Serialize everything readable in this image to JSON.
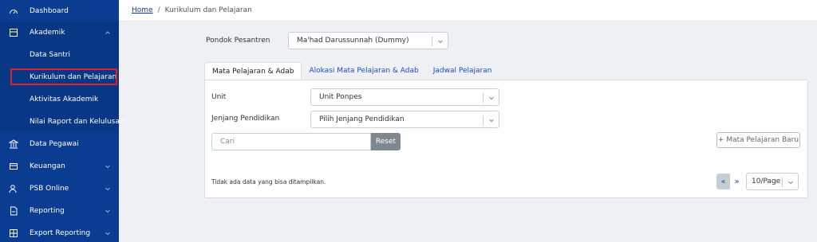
{
  "sidebar": {
    "items": [
      {
        "label": "Dashboard",
        "icon": "dashboard-icon"
      },
      {
        "label": "Akademik",
        "icon": "book-icon"
      },
      {
        "label": "Data Santri"
      },
      {
        "label": "Kurikulum dan Pelajaran"
      },
      {
        "label": "Aktivitas Akademik"
      },
      {
        "label": "Nilai Raport dan Kelulusan"
      },
      {
        "label": "Data Pegawai",
        "icon": "building-icon"
      },
      {
        "label": "Keuangan",
        "icon": "wallet-icon"
      },
      {
        "label": "PSB Online",
        "icon": "users-icon"
      },
      {
        "label": "Reporting",
        "icon": "file-icon"
      },
      {
        "label": "Export Reporting",
        "icon": "table-icon"
      }
    ]
  },
  "breadcrumb": {
    "home": "Home",
    "current": "Kurikulum dan Pelajaran"
  },
  "pesantren": {
    "label": "Pondok Pesantren",
    "value": "Ma'had Darussunnah (Dummy)"
  },
  "tabs": [
    {
      "label": "Mata Pelajaran & Adab"
    },
    {
      "label": "Alokasi Mata Pelajaran & Adab"
    },
    {
      "label": "Jadwal Pelajaran"
    }
  ],
  "filters": {
    "unit_label": "Unit",
    "unit_value": "Unit Ponpes",
    "jenjang_label": "Jenjang Pendidikan",
    "jenjang_value": "Pilih Jenjang Pendidikan"
  },
  "search": {
    "placeholder": "Cari",
    "reset_label": "Reset"
  },
  "add_button": "+ Mata Pelajaran Baru",
  "empty_message": "Tidak ada data yang bisa ditampilkan.",
  "pagination": {
    "prev": "«",
    "next": "»",
    "page_size": "10/Page"
  },
  "colors": {
    "sidebar": "#0a3d91",
    "accent": "#1a4fc2",
    "highlight": "#e0202a"
  }
}
